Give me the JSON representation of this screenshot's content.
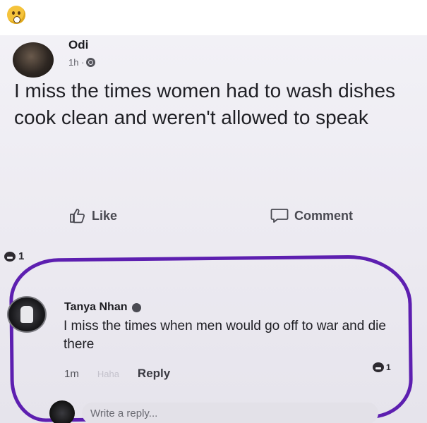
{
  "post": {
    "author": "Odi",
    "time": "1h ·",
    "text": "I miss the times women had to wash dishes cook clean and weren't allowed to speak",
    "like_label": "Like",
    "comment_label": "Comment",
    "reaction_count": "1"
  },
  "comment": {
    "author": "Tanya Nhan",
    "text": "I miss the times when men would go off to war and die there",
    "time": "1m",
    "haha_label": "Haha",
    "reply_label": "Reply",
    "reaction_count": "1"
  },
  "reply_box": {
    "placeholder": "Write a reply..."
  },
  "colors": {
    "highlight": "#5d1fb0"
  }
}
